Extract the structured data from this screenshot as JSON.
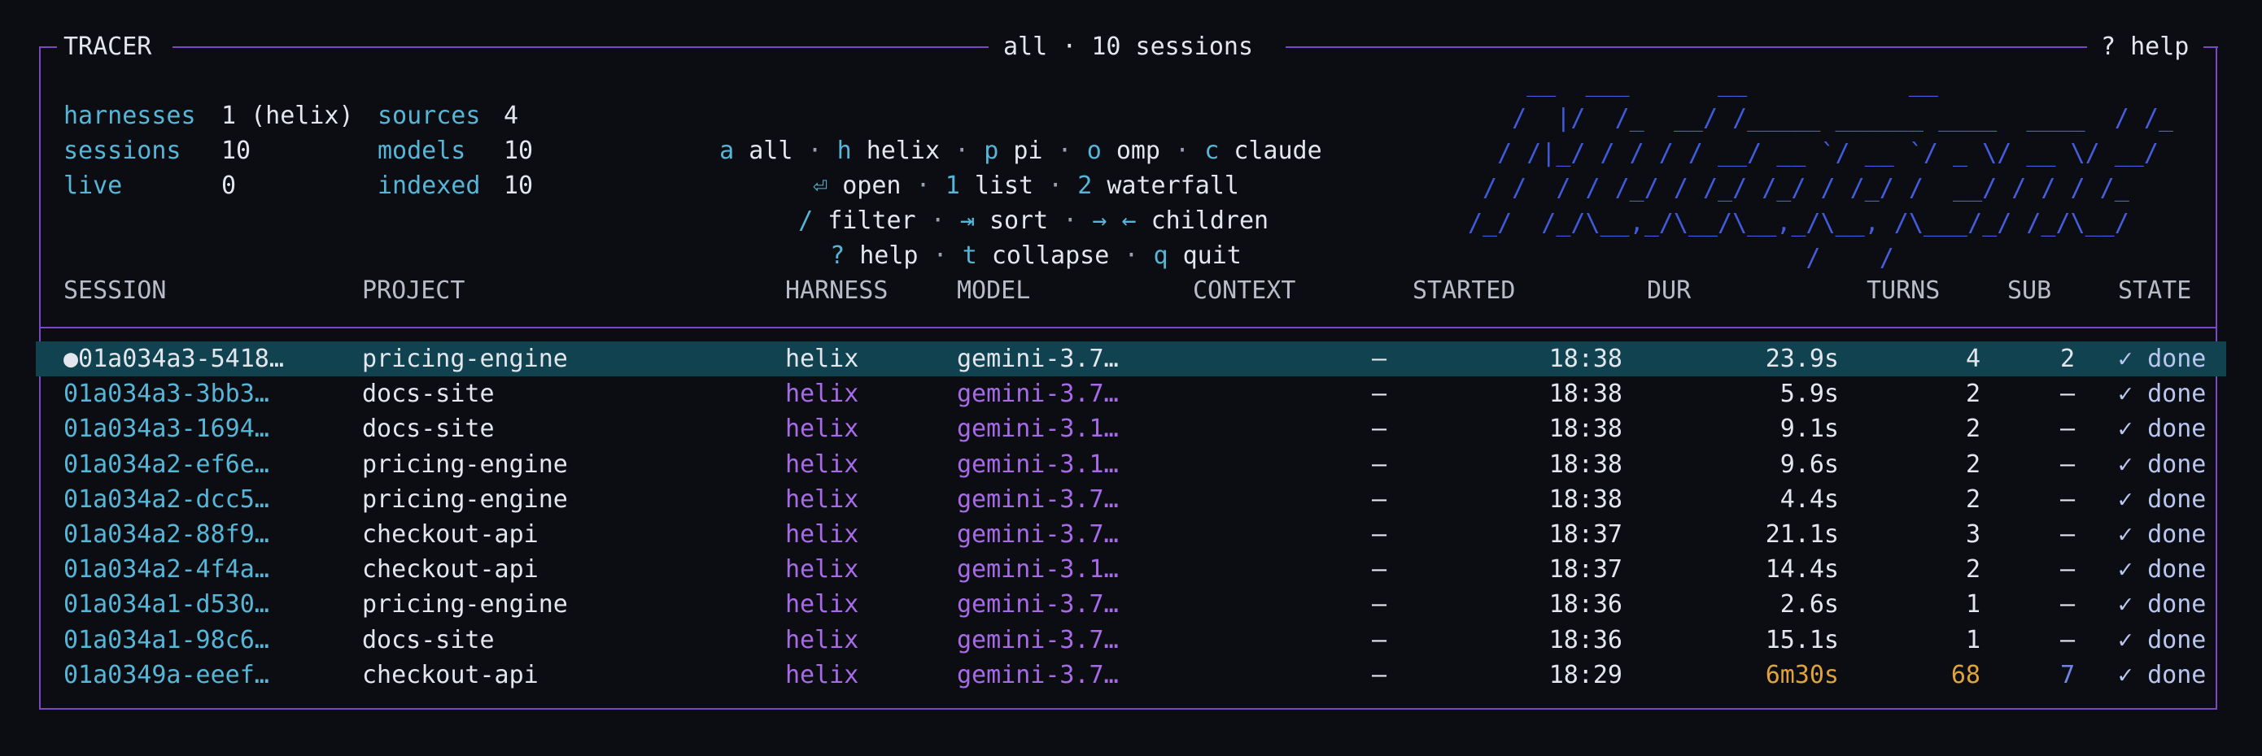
{
  "header": {
    "app_name": "TRACER",
    "center_title": "all · 10 sessions",
    "help": "? help"
  },
  "stats": [
    {
      "label": "harnesses",
      "value": "1 (helix)"
    },
    {
      "label": "sessions",
      "value": "10"
    },
    {
      "label": "live",
      "value": "0"
    },
    {
      "label": "sources",
      "value": "4"
    },
    {
      "label": "models",
      "value": "10"
    },
    {
      "label": "indexed",
      "value": "10"
    }
  ],
  "keys": {
    "line1": [
      {
        "key": "a",
        "label": "all"
      },
      {
        "key": "h",
        "label": "helix"
      },
      {
        "key": "p",
        "label": "pi"
      },
      {
        "key": "o",
        "label": "omp"
      },
      {
        "key": "c",
        "label": "claude"
      }
    ],
    "line2": [
      {
        "key": "⏎",
        "label": "open"
      },
      {
        "key": "1",
        "label": "list"
      },
      {
        "key": "2",
        "label": "waterfall"
      }
    ],
    "line3": [
      {
        "key": "/",
        "label": "filter"
      },
      {
        "key": "⇥",
        "label": "sort"
      },
      {
        "key": "→ ←",
        "label": "children"
      }
    ],
    "line4": [
      {
        "key": "?",
        "label": "help"
      },
      {
        "key": "t",
        "label": "collapse"
      },
      {
        "key": "q",
        "label": "quit"
      }
    ],
    "separator": " · "
  },
  "logo_ascii": [
    "    __  ___      __           __",
    "   /  |/  /_  __/ /_____ ______ ____  ____  / /_",
    "  / /|_/ / / / / __/ __ `/ __ `/ _ \\/ __ \\/ __/",
    " / /  / / /_/ / /_/ /_/ / /_/ /  __/ / / / /_",
    "/_/  /_/\\__,_/\\__/\\__,_/\\__, /\\___/_/ /_/\\__/",
    "                       /____/"
  ],
  "table": {
    "columns": [
      "SESSION",
      "PROJECT",
      "HARNESS",
      "MODEL",
      "CONTEXT",
      "STARTED",
      "DUR",
      "TURNS",
      "SUB",
      "STATE"
    ],
    "rows": [
      {
        "session": "●01a034a3-5418…",
        "project": "pricing-engine",
        "harness": "helix",
        "model": "gemini-3.7…",
        "context": "—",
        "started": "18:38",
        "dur": "23.9s",
        "turns": "4",
        "sub": "2",
        "state": "✓ done"
      },
      {
        "session": "01a034a3-3bb3…",
        "project": "docs-site",
        "harness": "helix",
        "model": "gemini-3.7…",
        "context": "—",
        "started": "18:38",
        "dur": "5.9s",
        "turns": "2",
        "sub": "—",
        "state": "✓ done"
      },
      {
        "session": "01a034a3-1694…",
        "project": "docs-site",
        "harness": "helix",
        "model": "gemini-3.1…",
        "context": "—",
        "started": "18:38",
        "dur": "9.1s",
        "turns": "2",
        "sub": "—",
        "state": "✓ done"
      },
      {
        "session": "01a034a2-ef6e…",
        "project": "pricing-engine",
        "harness": "helix",
        "model": "gemini-3.1…",
        "context": "—",
        "started": "18:38",
        "dur": "9.6s",
        "turns": "2",
        "sub": "—",
        "state": "✓ done"
      },
      {
        "session": "01a034a2-dcc5…",
        "project": "pricing-engine",
        "harness": "helix",
        "model": "gemini-3.7…",
        "context": "—",
        "started": "18:38",
        "dur": "4.4s",
        "turns": "2",
        "sub": "—",
        "state": "✓ done"
      },
      {
        "session": "01a034a2-88f9…",
        "project": "checkout-api",
        "harness": "helix",
        "model": "gemini-3.7…",
        "context": "—",
        "started": "18:37",
        "dur": "21.1s",
        "turns": "3",
        "sub": "—",
        "state": "✓ done"
      },
      {
        "session": "01a034a2-4f4a…",
        "project": "checkout-api",
        "harness": "helix",
        "model": "gemini-3.1…",
        "context": "—",
        "started": "18:37",
        "dur": "14.4s",
        "turns": "2",
        "sub": "—",
        "state": "✓ done"
      },
      {
        "session": "01a034a1-d530…",
        "project": "pricing-engine",
        "harness": "helix",
        "model": "gemini-3.7…",
        "context": "—",
        "started": "18:36",
        "dur": "2.6s",
        "turns": "1",
        "sub": "—",
        "state": "✓ done"
      },
      {
        "session": "01a034a1-98c6…",
        "project": "docs-site",
        "harness": "helix",
        "model": "gemini-3.7…",
        "context": "—",
        "started": "18:36",
        "dur": "15.1s",
        "turns": "1",
        "sub": "—",
        "state": "✓ done"
      },
      {
        "session": "01a0349a-eeef…",
        "project": "checkout-api",
        "harness": "helix",
        "model": "gemini-3.7…",
        "context": "—",
        "started": "18:29",
        "dur": "6m30s",
        "turns": "68",
        "sub": "7",
        "state": "✓ done"
      }
    ]
  },
  "colors": {
    "border": "#7a48c6",
    "accent_cyan": "#56b6d8",
    "accent_purple": "#a86be8",
    "highlight_row": "#10434f",
    "warning_orange": "#e0a23a",
    "background": "#0b0d12"
  }
}
